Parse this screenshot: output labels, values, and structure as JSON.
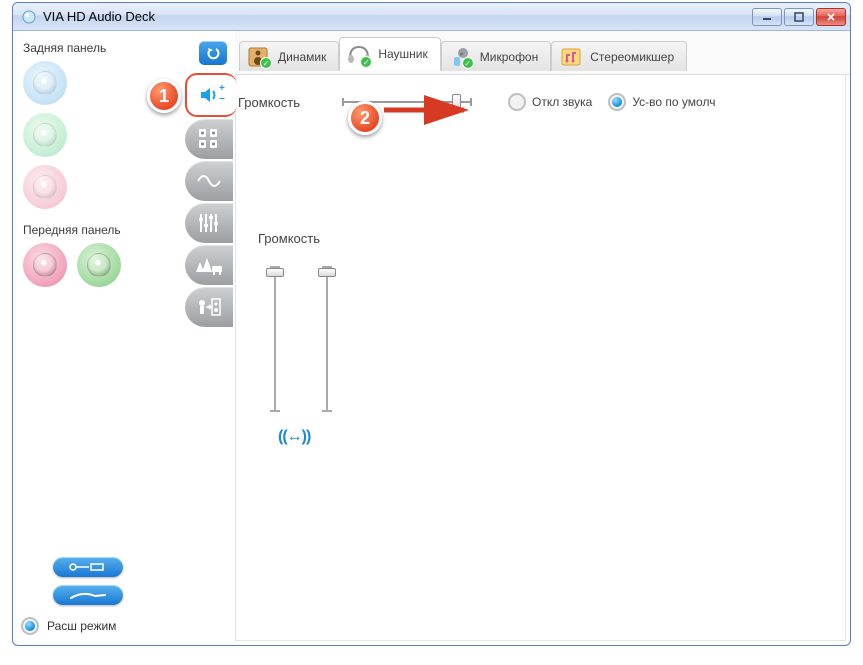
{
  "window": {
    "title": "VIA HD Audio Deck"
  },
  "left": {
    "rear_label": "Задняя панель",
    "front_label": "Передняя панель",
    "mode_label": "Расш режим"
  },
  "tabs": {
    "speaker": "Динамик",
    "headphone": "Наушник",
    "mic": "Микрофон",
    "stereomix": "Стереомикшер"
  },
  "main": {
    "volume_label": "Громкость",
    "mute_label": "Откл звука",
    "default_label": "Ус-во по умолч",
    "volume2_label": "Громкость",
    "hslider_pos_pct": 92,
    "vslider_left_pct": 4,
    "vslider_right_pct": 4
  },
  "annotations": {
    "badge1": "1",
    "badge2": "2"
  }
}
